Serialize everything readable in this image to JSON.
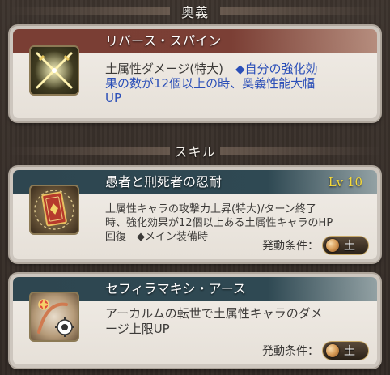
{
  "sections": {
    "ougi_header": "奥義",
    "skill_header": "スキル"
  },
  "ougi": {
    "name": "リバース・スパイン",
    "desc_line1_a": "土属性ダメージ(特大)　",
    "desc_line1_b": "◆自分の強化効",
    "desc_line2": "果の数が12個以上の時、奥義性能大幅",
    "desc_line3": "UP",
    "icon": "crossed-swords-icon"
  },
  "skills": [
    {
      "name": "愚者と刑死者の忍耐",
      "level": "Lv 10",
      "desc_line1": "土属性キャラの攻撃力上昇(特大)/ターン終了",
      "desc_line2": "時、強化効果が12個以上ある土属性キャラのHP",
      "desc_line3": "回復　◆メイン装備時",
      "condition_label": "発動条件：",
      "condition_element": "土",
      "icon": "tarot-card-icon"
    },
    {
      "name": "セフィラマキシ・アース",
      "desc_line1": "アーカルムの転世で土属性キャラのダメ",
      "desc_line2": "ージ上限UP",
      "condition_label": "発動条件：",
      "condition_element": "土",
      "icon": "sephira-maxi-icon"
    }
  ],
  "colors": {
    "ougi_title_bar": "#7a3e34",
    "skill_title_bar": "#2e4650",
    "level_text": "#f6da3a",
    "ougi_effect_text": "#2b4fb8"
  }
}
